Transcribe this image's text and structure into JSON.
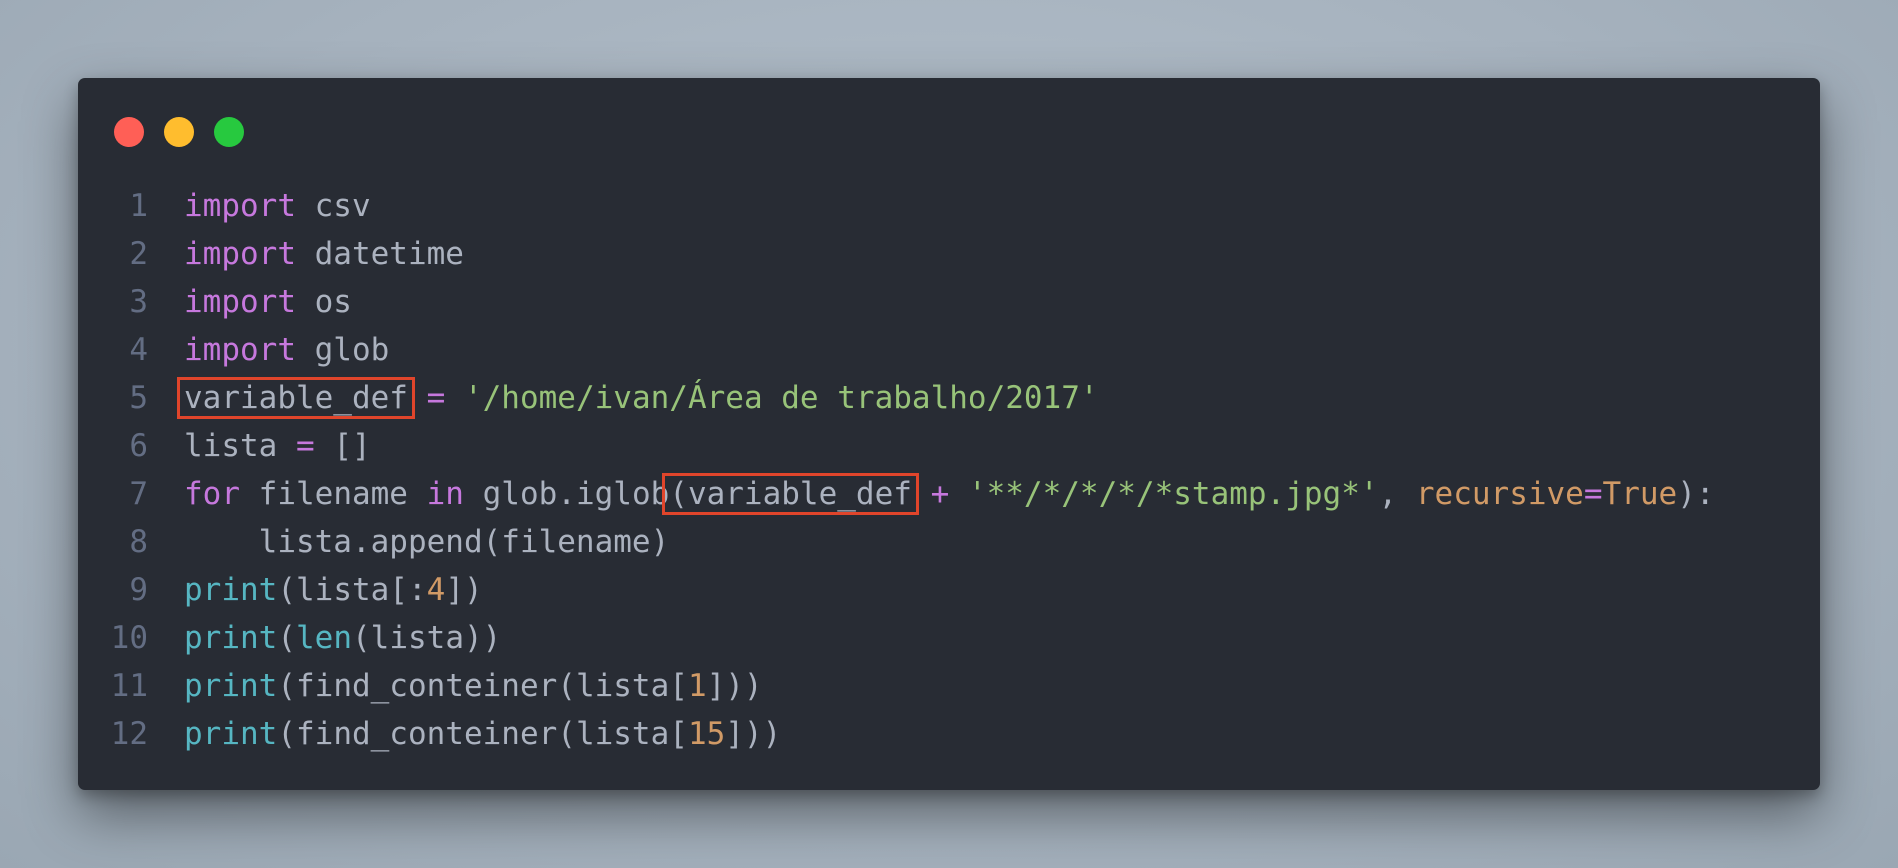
{
  "window_controls": {
    "close_color": "#ff5f56",
    "minimize_color": "#ffbd2e",
    "maximize_color": "#27c93f"
  },
  "code": {
    "lines": [
      {
        "n": "1",
        "parts": [
          [
            "kw",
            "import"
          ],
          [
            "txt",
            " csv"
          ]
        ]
      },
      {
        "n": "2",
        "parts": [
          [
            "kw",
            "import"
          ],
          [
            "txt",
            " datetime"
          ]
        ]
      },
      {
        "n": "3",
        "parts": [
          [
            "kw",
            "import"
          ],
          [
            "txt",
            " os"
          ]
        ]
      },
      {
        "n": "4",
        "parts": [
          [
            "kw",
            "import"
          ],
          [
            "txt",
            " glob"
          ]
        ]
      },
      {
        "n": "5",
        "parts": [
          [
            "hl",
            "variable_def"
          ],
          [
            "txt",
            " "
          ],
          [
            "kw",
            "="
          ],
          [
            "txt",
            " "
          ],
          [
            "str",
            "'/home/ivan/Área de trabalho/2017'"
          ]
        ]
      },
      {
        "n": "6",
        "parts": [
          [
            "txt",
            "lista "
          ],
          [
            "kw",
            "="
          ],
          [
            "txt",
            " []"
          ]
        ]
      },
      {
        "n": "7",
        "parts": [
          [
            "kw",
            "for"
          ],
          [
            "txt",
            " filename "
          ],
          [
            "kw",
            "in"
          ],
          [
            "txt",
            " glob.iglob"
          ],
          [
            "hl",
            "(variable_def"
          ],
          [
            "txt",
            " "
          ],
          [
            "kw",
            "+"
          ],
          [
            "txt",
            " "
          ],
          [
            "str",
            "'**/*/*/*/*stamp.jpg*'"
          ],
          [
            "txt",
            ", "
          ],
          [
            "param2",
            "recursive"
          ],
          [
            "kw",
            "="
          ],
          [
            "param2",
            "True"
          ],
          [
            "txt",
            "):"
          ]
        ]
      },
      {
        "n": "8",
        "parts": [
          [
            "txt",
            "    lista.append(filename)"
          ]
        ]
      },
      {
        "n": "9",
        "parts": [
          [
            "fn",
            "print"
          ],
          [
            "txt",
            "(lista[:"
          ],
          [
            "num",
            "4"
          ],
          [
            "txt",
            "])"
          ]
        ]
      },
      {
        "n": "10",
        "parts": [
          [
            "fn",
            "print"
          ],
          [
            "txt",
            "("
          ],
          [
            "fn",
            "len"
          ],
          [
            "txt",
            "(lista))"
          ]
        ]
      },
      {
        "n": "11",
        "parts": [
          [
            "fn",
            "print"
          ],
          [
            "txt",
            "(find_conteiner(lista["
          ],
          [
            "num",
            "1"
          ],
          [
            "txt",
            "]))"
          ]
        ]
      },
      {
        "n": "12",
        "parts": [
          [
            "fn",
            "print"
          ],
          [
            "txt",
            "(find_conteiner(lista["
          ],
          [
            "num",
            "15"
          ],
          [
            "txt",
            "]))"
          ]
        ]
      }
    ]
  }
}
